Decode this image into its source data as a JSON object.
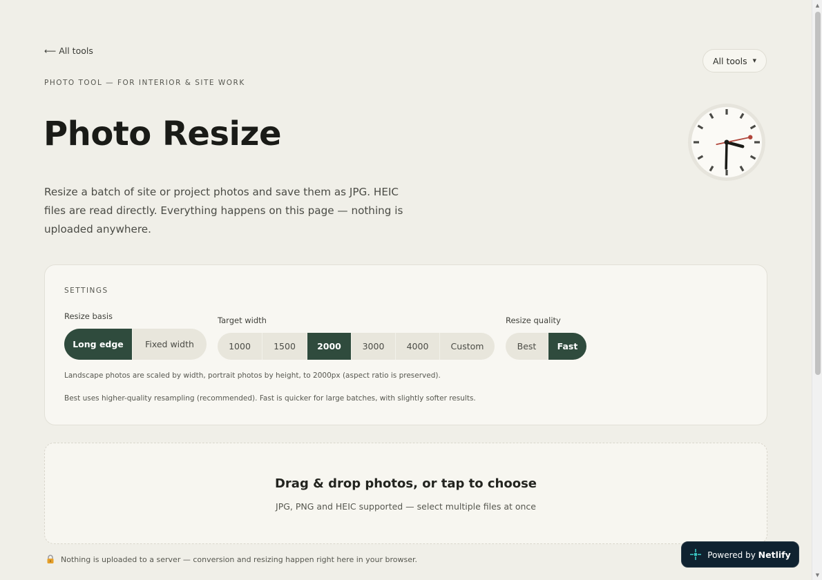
{
  "nav": {
    "back_label": "All tools",
    "back_arrow": "⟵",
    "tools_select_label": "All tools",
    "tools_select_caret": "▼"
  },
  "hero": {
    "eyebrow": "PHOTO TOOL — FOR INTERIOR & SITE WORK",
    "title": "Photo Resize",
    "lead": "Resize a batch of site or project photos and save them as JPG. HEIC files are read directly. Everything happens on this page — nothing is uploaded anywhere."
  },
  "clock": {
    "hours": 3,
    "minutes": 30,
    "seconds": 13
  },
  "settings": {
    "heading": "SETTINGS",
    "resize_basis": {
      "label": "Resize basis",
      "options": [
        "Long edge",
        "Fixed width"
      ],
      "selected": "Long edge"
    },
    "target_width": {
      "label": "Target width",
      "options": [
        "1000",
        "1500",
        "2000",
        "3000",
        "4000",
        "Custom"
      ],
      "selected": "2000"
    },
    "resize_quality": {
      "label": "Resize quality",
      "options": [
        "Best",
        "Fast"
      ],
      "selected": "Fast"
    },
    "hint_basis": "Landscape photos are scaled by width, portrait photos by height, to 2000px (aspect ratio is preserved).",
    "hint_quality": "Best uses higher-quality resampling (recommended). Fast is quicker for large batches, with slightly softer results."
  },
  "dropzone": {
    "title": "Drag & drop photos, or tap to choose",
    "subtitle": "JPG, PNG and HEIC supported — select multiple files at once"
  },
  "footnote": {
    "icon": "lock-icon",
    "text": "Nothing is uploaded to a server — conversion and resizing happen right here in your browser."
  },
  "badge": {
    "prefix": "Powered by",
    "brand": "Netlify"
  },
  "colors": {
    "background": "#f0efe8",
    "accent": "#2f4b3d",
    "second_hand": "#b0453a",
    "badge_bg": "#0f2230",
    "badge_logo": "#3ac5c2"
  }
}
